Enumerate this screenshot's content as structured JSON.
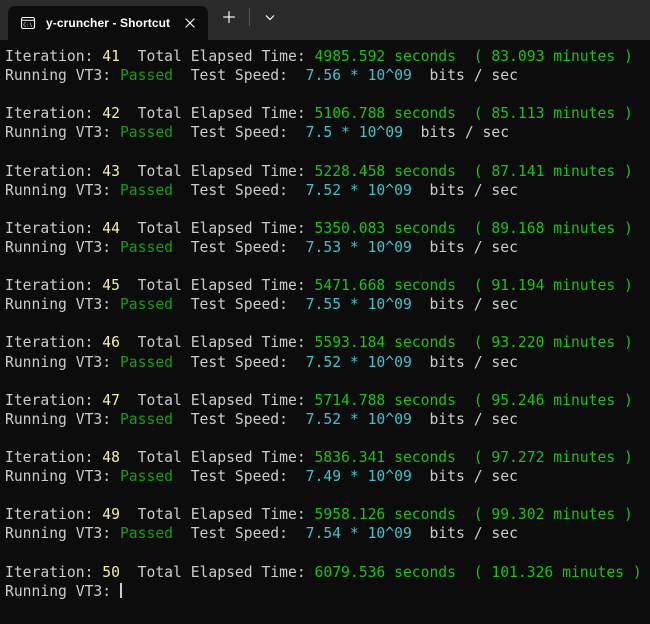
{
  "window": {
    "tab": {
      "icon": "console-cmd-icon",
      "title": "y-cruncher - Shortcut",
      "close_label": "×"
    },
    "new_tab_label": "+",
    "dropdown_label": "⌄",
    "colors": {
      "titlebar_bg": "#2b2b2b",
      "terminal_bg": "#0c0c0c",
      "default_fg": "#cccccc",
      "iteration_number": "#f2f0a0",
      "elapsed_green": "#16c60c",
      "passed_green": "#13a10e",
      "speed_cyan": "#3ac5c9"
    }
  },
  "terminal": {
    "labels": {
      "iteration": "Iteration:",
      "total_elapsed": "Total Elapsed Time:",
      "seconds_unit": "seconds",
      "minutes_unit": "minutes",
      "paren_open": "(",
      "paren_close": ")",
      "running": "Running VT3:",
      "test_speed": "Test Speed:",
      "bits_per_sec": "bits / sec",
      "passed": "Passed",
      "mantissa_exponent_sep": "*",
      "exponent": "10^09"
    },
    "iterations": [
      {
        "number": "41",
        "elapsed_seconds": "4985.592",
        "elapsed_minutes": "83.093",
        "status": "Passed",
        "speed_mantissa": "7.56"
      },
      {
        "number": "42",
        "elapsed_seconds": "5106.788",
        "elapsed_minutes": "85.113",
        "status": "Passed",
        "speed_mantissa": "7.5"
      },
      {
        "number": "43",
        "elapsed_seconds": "5228.458",
        "elapsed_minutes": "87.141",
        "status": "Passed",
        "speed_mantissa": "7.52"
      },
      {
        "number": "44",
        "elapsed_seconds": "5350.083",
        "elapsed_minutes": "89.168",
        "status": "Passed",
        "speed_mantissa": "7.53"
      },
      {
        "number": "45",
        "elapsed_seconds": "5471.668",
        "elapsed_minutes": "91.194",
        "status": "Passed",
        "speed_mantissa": "7.55"
      },
      {
        "number": "46",
        "elapsed_seconds": "5593.184",
        "elapsed_minutes": "93.220",
        "status": "Passed",
        "speed_mantissa": "7.52"
      },
      {
        "number": "47",
        "elapsed_seconds": "5714.788",
        "elapsed_minutes": "95.246",
        "status": "Passed",
        "speed_mantissa": "7.52"
      },
      {
        "number": "48",
        "elapsed_seconds": "5836.341",
        "elapsed_minutes": "97.272",
        "status": "Passed",
        "speed_mantissa": "7.49"
      },
      {
        "number": "49",
        "elapsed_seconds": "5958.126",
        "elapsed_minutes": "99.302",
        "status": "Passed",
        "speed_mantissa": "7.54"
      },
      {
        "number": "50",
        "elapsed_seconds": "6079.536",
        "elapsed_minutes": "101.326",
        "status": "",
        "speed_mantissa": "",
        "in_progress": true
      }
    ]
  }
}
